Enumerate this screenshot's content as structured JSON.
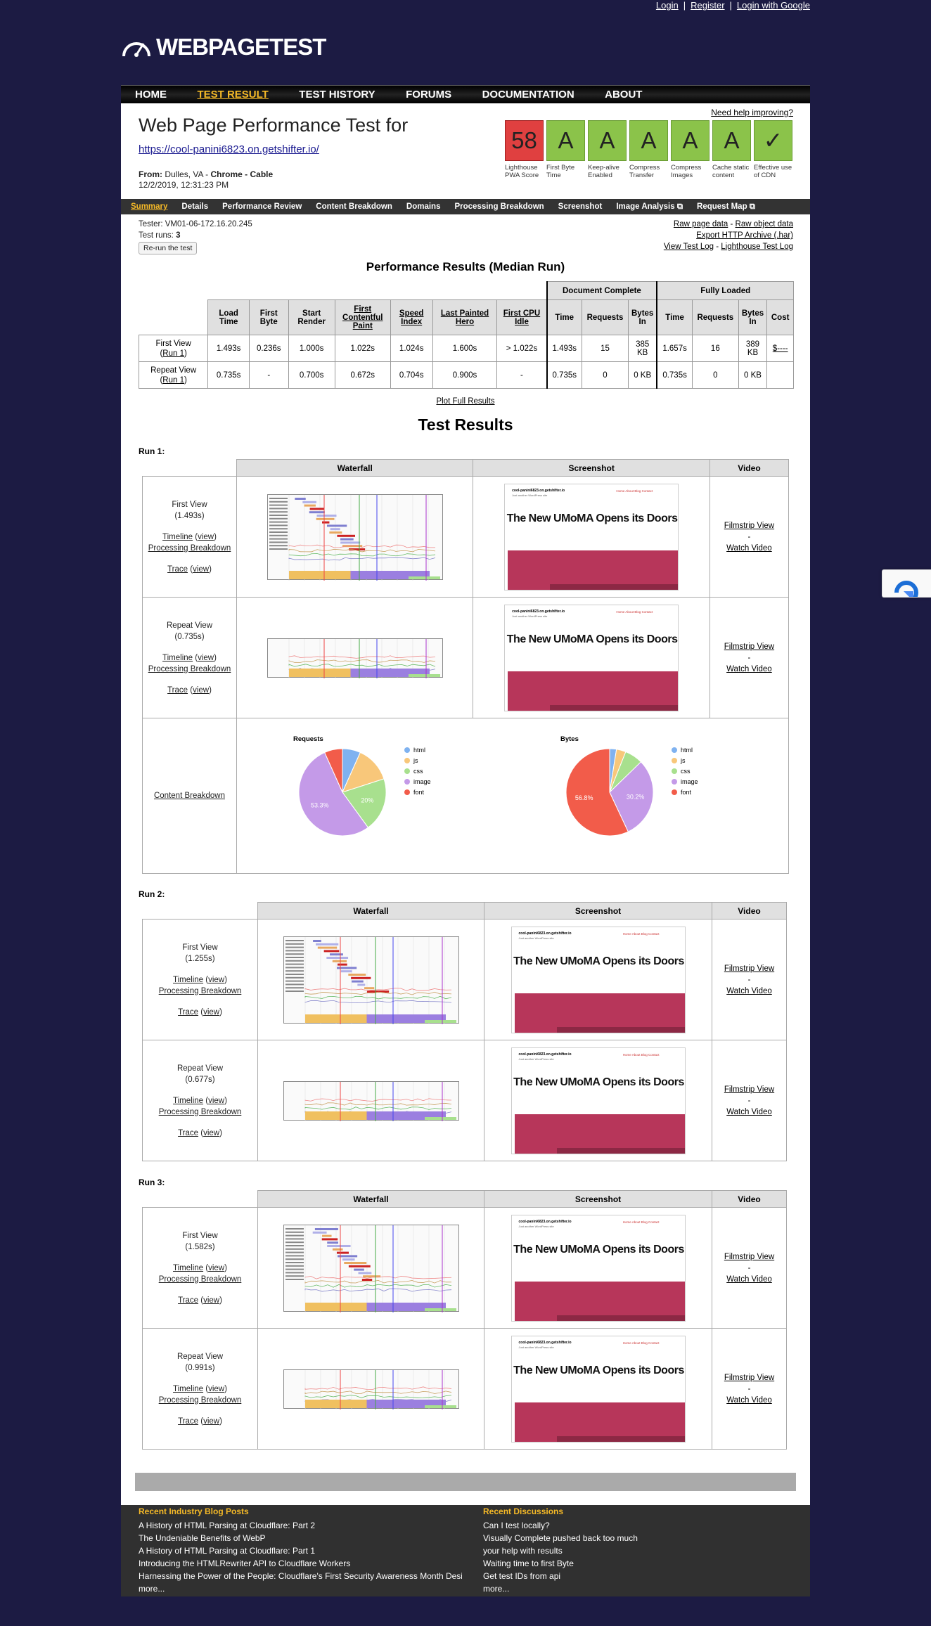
{
  "top_links": {
    "login": "Login",
    "register": "Register",
    "login_google": "Login with Google"
  },
  "logo_text": "WEBPAGETEST",
  "nav": [
    "HOME",
    "TEST RESULT",
    "TEST HISTORY",
    "FORUMS",
    "DOCUMENTATION",
    "ABOUT"
  ],
  "nav_active": "TEST RESULT",
  "header": {
    "title": "Web Page Performance Test for",
    "url": "https://cool-panini6823.on.getshifter.io/",
    "from_label": "From:",
    "from_location": "Dulles, VA -",
    "from_browser": "Chrome - Cable",
    "date": "12/2/2019, 12:31:23 PM",
    "help": "Need help improving?"
  },
  "grades": [
    {
      "value": "58",
      "label": "Lighthouse PWA Score",
      "color": "#e04040"
    },
    {
      "value": "A",
      "label": "First Byte Time",
      "color": "#8bc34a"
    },
    {
      "value": "A",
      "label": "Keep-alive Enabled",
      "color": "#8bc34a"
    },
    {
      "value": "A",
      "label": "Compress Transfer",
      "color": "#8bc34a"
    },
    {
      "value": "A",
      "label": "Compress Images",
      "color": "#8bc34a"
    },
    {
      "value": "A",
      "label": "Cache static content",
      "color": "#8bc34a"
    },
    {
      "value": "✓",
      "label": "Effective use of CDN",
      "color": "#8bc34a"
    }
  ],
  "subnav": [
    "Summary",
    "Details",
    "Performance Review",
    "Content Breakdown",
    "Domains",
    "Processing Breakdown",
    "Screenshot",
    "Image Analysis ⧉",
    "Request Map ⧉"
  ],
  "tester": {
    "tester": "Tester: VM01-06-172.16.20.245",
    "runs_label": "Test runs:",
    "runs_value": "3",
    "rerun": "Re-run the test"
  },
  "raw_links": {
    "raw_page": "Raw page data",
    "raw_object": "Raw object data",
    "export": "Export HTTP Archive (.har)",
    "log": "View Test Log",
    "lighthouse_log": "Lighthouse Test Log"
  },
  "perf": {
    "title": "Performance Results (Median Run)",
    "group_doc": "Document Complete",
    "group_full": "Fully Loaded",
    "headers": [
      "Load Time",
      "First Byte",
      "Start Render",
      "First Contentful Paint",
      "Speed Index",
      "Last Painted Hero",
      "First CPU Idle",
      "Time",
      "Requests",
      "Bytes In",
      "Time",
      "Requests",
      "Bytes In",
      "Cost"
    ],
    "rows": [
      {
        "label": "First View",
        "run": "Run 1",
        "cells": [
          "1.493s",
          "0.236s",
          "1.000s",
          "1.022s",
          "1.024s",
          "1.600s",
          "> 1.022s",
          "1.493s",
          "15",
          "385 KB",
          "1.657s",
          "16",
          "389 KB",
          "$----"
        ]
      },
      {
        "label": "Repeat View",
        "run": "Run 1",
        "cells": [
          "0.735s",
          "-",
          "0.700s",
          "0.672s",
          "0.704s",
          "0.900s",
          "-",
          "0.735s",
          "0",
          "0 KB",
          "0.735s",
          "0",
          "0 KB",
          ""
        ]
      }
    ],
    "plot_full": "Plot Full Results"
  },
  "test_results_title": "Test Results",
  "columns": {
    "waterfall": "Waterfall",
    "screenshot": "Screenshot",
    "video": "Video"
  },
  "links": {
    "timeline": "Timeline",
    "view": "view",
    "processing": "Processing Breakdown",
    "trace": "Trace",
    "filmstrip": "Filmstrip View",
    "dash": "-",
    "watch": "Watch Video",
    "content_breakdown": "Content Breakdown"
  },
  "screenshot": {
    "site": "cool-panini6823.on.getshifter.io",
    "tagline": "Just another WordPress site",
    "menu": "Home   About   Blog   Contact",
    "headline": "The New UMoMA Opens its Doors"
  },
  "runs": [
    {
      "label": "Run 1:",
      "first": {
        "name": "First View",
        "time": "(1.493s)"
      },
      "repeat": {
        "name": "Repeat View",
        "time": "(0.735s)"
      }
    },
    {
      "label": "Run 2:",
      "first": {
        "name": "First View",
        "time": "(1.255s)"
      },
      "repeat": {
        "name": "Repeat View",
        "time": "(0.677s)"
      }
    },
    {
      "label": "Run 3:",
      "first": {
        "name": "First View",
        "time": "(1.582s)"
      },
      "repeat": {
        "name": "Repeat View",
        "time": "(0.991s)"
      }
    }
  ],
  "chart_data": [
    {
      "type": "pie",
      "title": "Requests",
      "categories": [
        "html",
        "js",
        "css",
        "image",
        "font"
      ],
      "values": [
        6.7,
        13.3,
        20,
        53.3,
        6.7
      ],
      "colors": [
        "#7fb2f0",
        "#f8c77a",
        "#a8e08e",
        "#c49ae8",
        "#f25c4a"
      ],
      "data_labels": [
        "",
        "",
        "20%",
        "53.3%",
        ""
      ]
    },
    {
      "type": "pie",
      "title": "Bytes",
      "categories": [
        "html",
        "js",
        "css",
        "image",
        "font"
      ],
      "values": [
        2.5,
        3.5,
        6.7,
        30.2,
        56.8
      ],
      "colors": [
        "#7fb2f0",
        "#f8c77a",
        "#a8e08e",
        "#c49ae8",
        "#f25c4a"
      ],
      "data_labels": [
        "",
        "",
        "",
        "30.2%",
        "56.8%"
      ]
    }
  ],
  "footer": {
    "blog_title": "Recent Industry Blog Posts",
    "blog_posts": [
      "A History of HTML Parsing at Cloudflare: Part 2",
      "The Undeniable Benefits of WebP",
      "A History of HTML Parsing at Cloudflare: Part 1",
      "Introducing the HTMLRewriter API to Cloudflare Workers",
      "Harnessing the Power of the People: Cloudflare's First Security Awareness Month Desig"
    ],
    "discussions_title": "Recent Discussions",
    "discussions": [
      "Can I test locally?",
      "Visually Complete pushed back too much",
      "your help with results",
      "Waiting time to first Byte",
      "Get test IDs from api"
    ],
    "more": "more..."
  }
}
